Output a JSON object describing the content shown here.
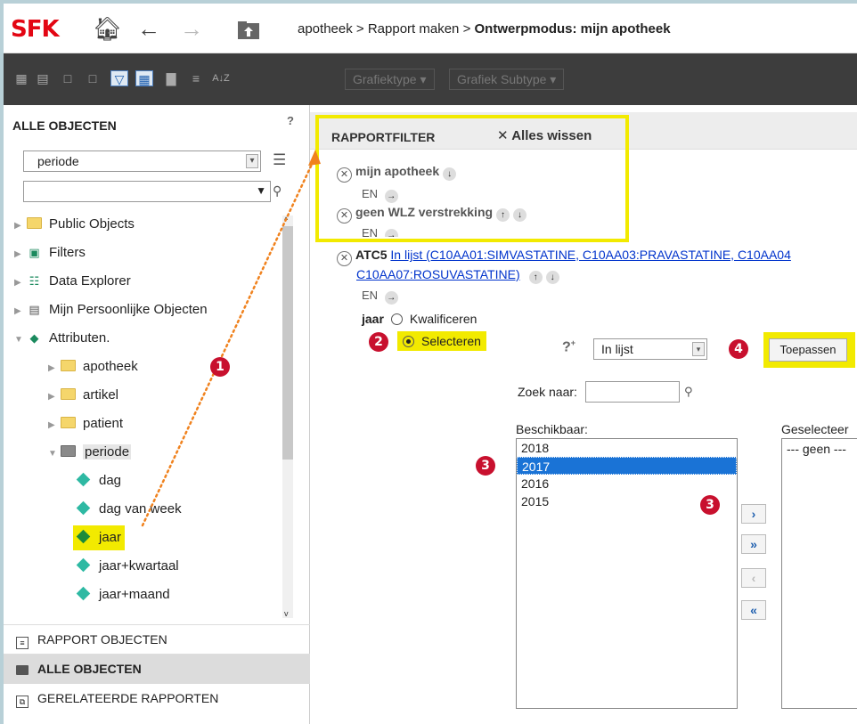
{
  "header": {
    "logo": "SFK",
    "breadcrumb": {
      "part1": "apotheek",
      "sep": ">",
      "part2": "Rapport maken",
      "current": "Ontwerpmodus: mijn apotheek"
    }
  },
  "toolbar": {
    "graph_type": "Grafiektype",
    "graph_subtype": "Grafiek Subtype",
    "sort_icon_label": "A↓Z"
  },
  "left_panel": {
    "title": "ALLE OBJECTEN",
    "help": "?",
    "dropdown_value": "periode",
    "search_value": "",
    "tree": [
      {
        "label": "Public Objects"
      },
      {
        "label": "Filters"
      },
      {
        "label": "Data Explorer"
      },
      {
        "label": "Mijn Persoonlijke Objecten"
      },
      {
        "label": "Attributen."
      },
      {
        "label": "apotheek"
      },
      {
        "label": "artikel"
      },
      {
        "label": "patient"
      },
      {
        "label": "periode"
      },
      {
        "label": "dag"
      },
      {
        "label": "dag van week"
      },
      {
        "label": "jaar"
      },
      {
        "label": "jaar+kwartaal"
      },
      {
        "label": "jaar+maand"
      }
    ],
    "bottom_tabs": [
      {
        "label": "RAPPORT OBJECTEN"
      },
      {
        "label": "ALLE OBJECTEN"
      },
      {
        "label": "GERELATEERDE RAPPORTEN"
      }
    ]
  },
  "report_filter": {
    "title": "RAPPORTFILTER",
    "clear_all": "Alles wissen",
    "filters": [
      {
        "name": "mijn apotheek"
      },
      {
        "name": "geen WLZ verstrekking"
      }
    ],
    "and_label": "EN",
    "atc": {
      "name": "ATC5",
      "link_line1": "In lijst  (C10AA01:SIMVASTATINE, C10AA03:PRAVASTATINE, C10AA04",
      "link_line2": "C10AA07:ROSUVASTATINE)"
    }
  },
  "editor": {
    "attribute": "jaar",
    "option_qualify": "Kwalificeren",
    "option_select": "Selecteren",
    "operator": "In lijst",
    "apply_button": "Toepassen",
    "search_label": "Zoek naar:",
    "search_value": "",
    "available_label": "Beschikbaar:",
    "selected_label": "Geselecteer",
    "available_items": [
      "2018",
      "2017",
      "2016",
      "2015"
    ],
    "selected_placeholder": "--- geen ---"
  },
  "badges": {
    "b1": "1",
    "b2": "2",
    "b3": "3",
    "b4": "4"
  },
  "colors": {
    "brand_red": "#e30613",
    "highlight_yellow": "#f2ea00",
    "selection_blue": "#1a73d6",
    "badge_red": "#c8102e"
  }
}
